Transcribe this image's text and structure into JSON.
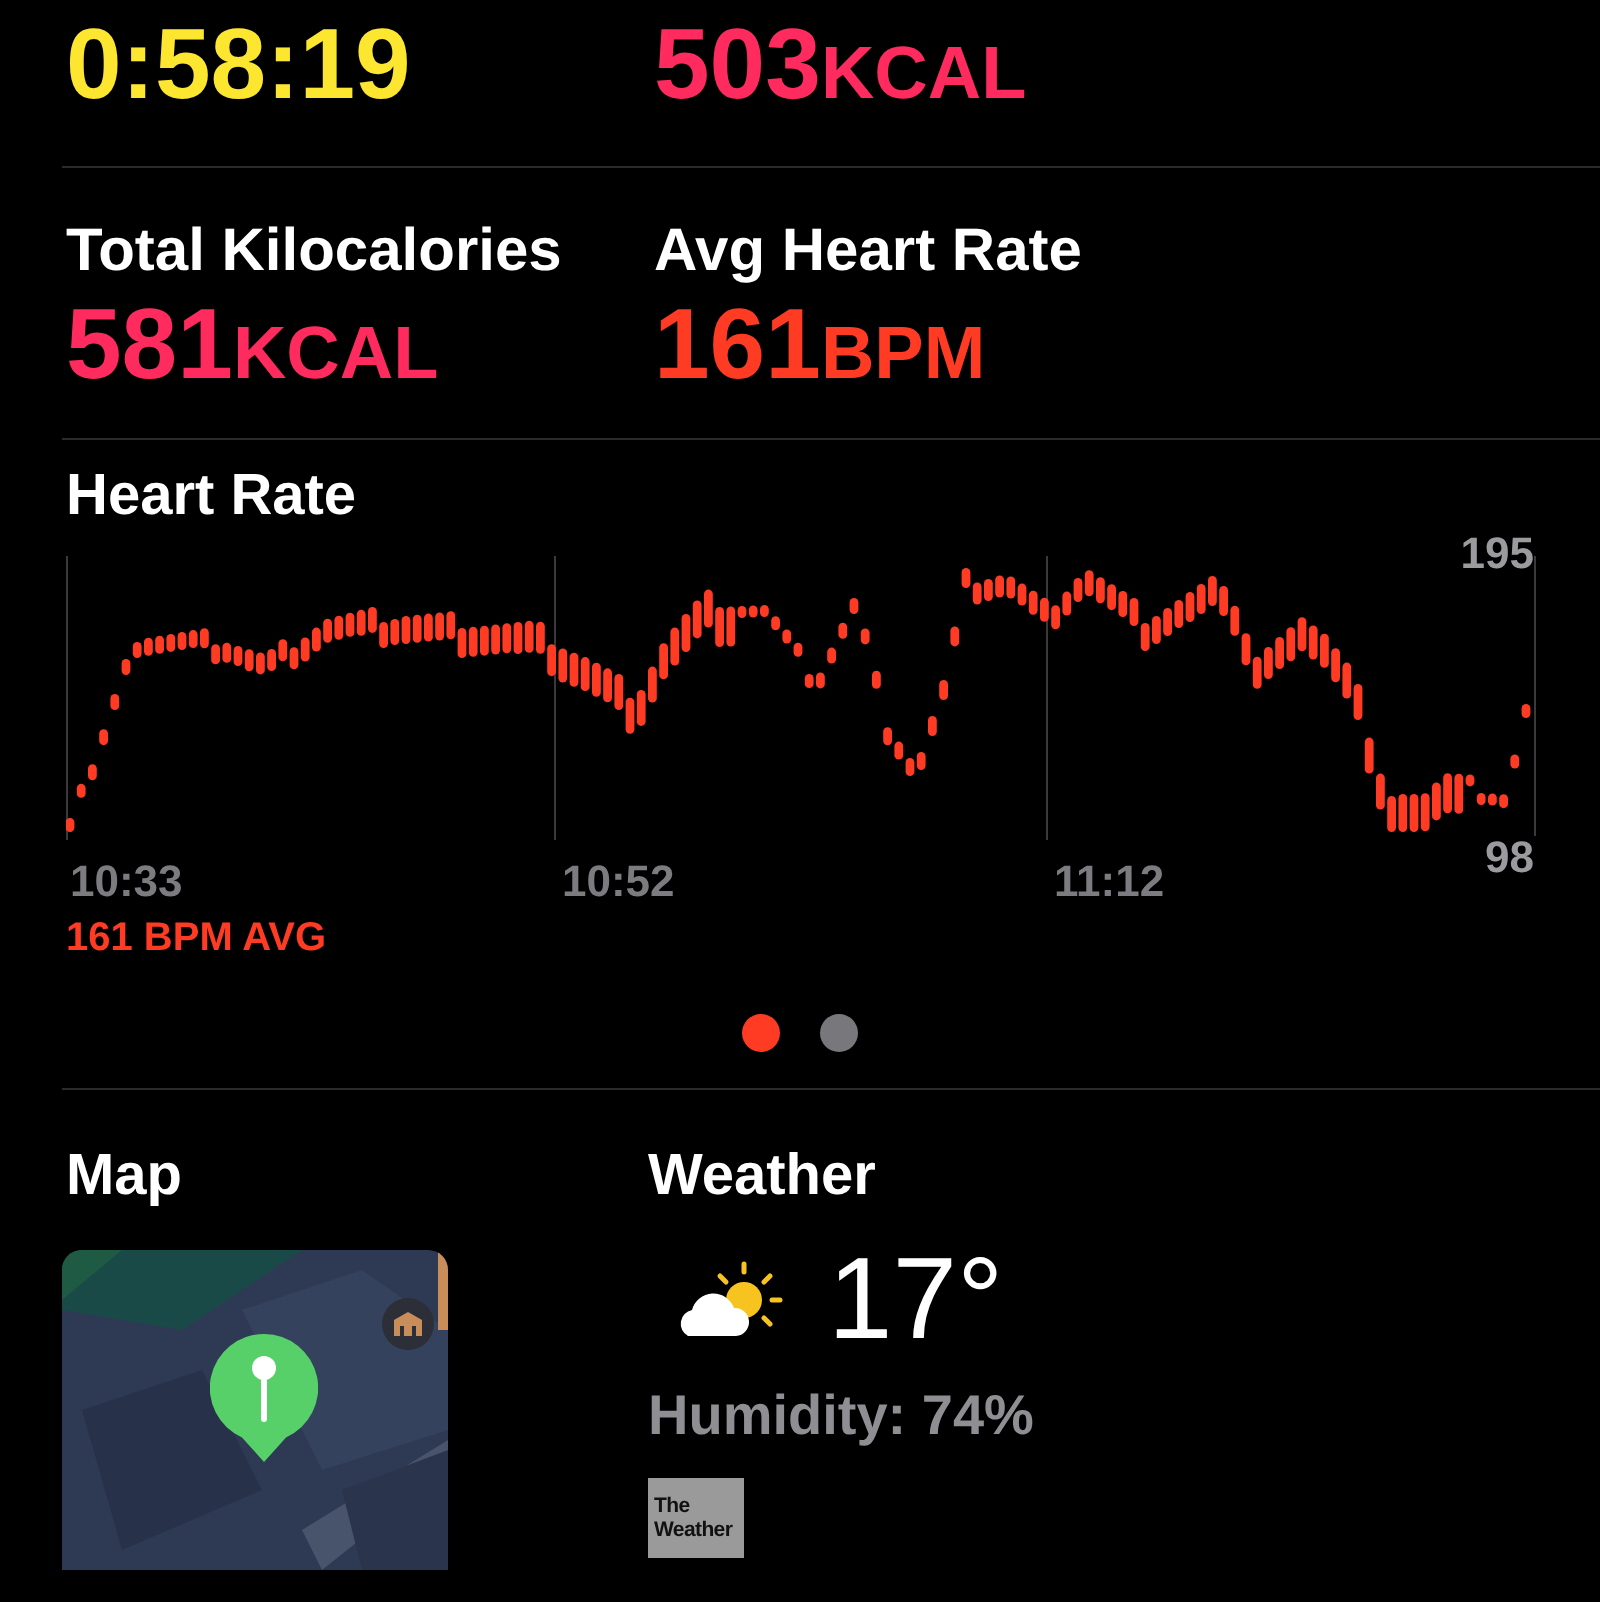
{
  "summary_rows": [
    {
      "stats": [
        {
          "value": "0:58:19",
          "color": "#fde62f"
        },
        {
          "value": "503",
          "unit": "KCAL",
          "color": "#ff2b5e"
        }
      ]
    },
    {
      "stats": [
        {
          "label": "Total Kilocalories",
          "value": "581",
          "unit": "KCAL",
          "color": "#ff2b5e"
        },
        {
          "label": "Avg Heart Rate",
          "value": "161",
          "unit": "BPM",
          "color": "#ff3b24"
        }
      ]
    }
  ],
  "heart_rate": {
    "title": "Heart Rate",
    "y_max_label": "195",
    "y_min_label": "98",
    "time_labels": [
      "10:33",
      "10:52",
      "11:12"
    ],
    "average": "161 BPM AVG"
  },
  "pager": [
    {
      "selected": true
    },
    {
      "selected": false
    }
  ],
  "map": {
    "title": "Map"
  },
  "weather": {
    "title": "Weather",
    "temperature": "17°",
    "humidity": "Humidity: 74%",
    "source_logo": "The Weather"
  }
}
